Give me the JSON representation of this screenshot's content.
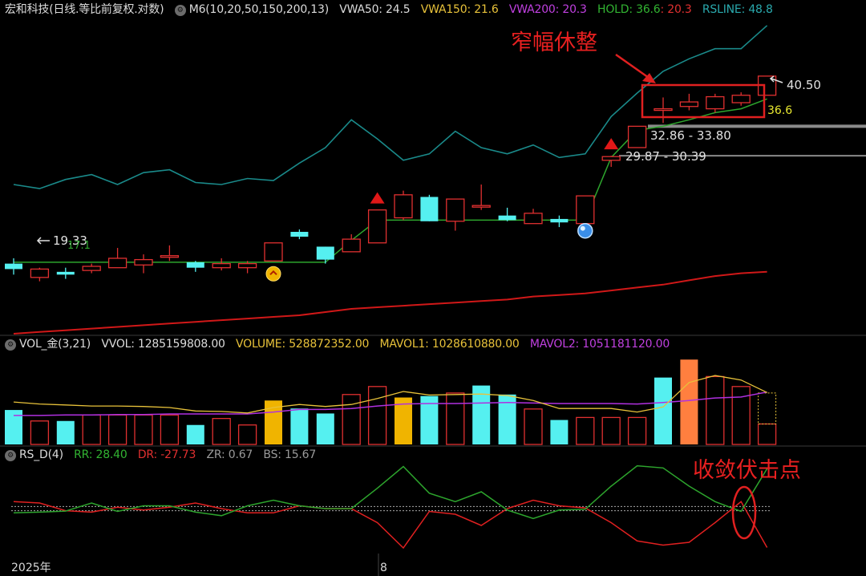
{
  "header": {
    "title": "宏和科技(日线.等比前复权.对数)",
    "indicator": "M6(10,20,50,150,200,13)",
    "vwa50": "VWA50: 24.5",
    "vwa150": "VWA150: 21.6",
    "vwa200": "VWA200: 20.3",
    "hold_green": "HOLD: 36.6",
    "hold_red": ": 20.3",
    "rsline": "RSLINE: 48.8"
  },
  "vol_header": {
    "name": "VOL_金(3,21)",
    "vvol": "VVOL: 1285159808.00",
    "volume": "VOLUME: 528872352.00",
    "mavol1": "MAVOL1: 1028610880.00",
    "mavol2": "MAVOL2: 1051181120.00"
  },
  "rs_header": {
    "name": "RS_D(4)",
    "rr": "RR: 28.40",
    "dr": "DR: -27.73",
    "zr": "ZR: 0.67",
    "bs": "BS: 15.67"
  },
  "annotations": {
    "consolidation": "窄幅休整",
    "convergence": "收敛伏击点",
    "label_high": "40.50",
    "label_hold": "36.6",
    "label_zone1": "32.86 - 33.80",
    "label_zone2": "29.87 - 30.39",
    "label_low": "19.33",
    "label_low_green": "17.1"
  },
  "time_axis": {
    "year_label": "2025年",
    "month_label": "8"
  },
  "colors": {
    "up": "#e03030",
    "down": "#55f0f0",
    "green": "#2da52d",
    "cyan_rs": "#1a8a8a",
    "red_ma": "#d01818",
    "yellow": "#f0b400",
    "orange": "#ff7f3f",
    "magenta": "#b030e0"
  },
  "chart_data": [
    {
      "type": "candlestick",
      "title": "宏和科技(日线.等比前复权.对数)",
      "candles": [
        {
          "o": 20.6,
          "c": 20.2,
          "h": 21.0,
          "l": 19.8
        },
        {
          "o": 19.6,
          "c": 20.2,
          "h": 20.3,
          "l": 19.33
        },
        {
          "o": 20.0,
          "c": 19.8,
          "h": 20.3,
          "l": 19.5
        },
        {
          "o": 20.1,
          "c": 20.4,
          "h": 20.6,
          "l": 19.9
        },
        {
          "o": 20.3,
          "c": 21.0,
          "h": 21.8,
          "l": 20.3
        },
        {
          "o": 20.5,
          "c": 20.9,
          "h": 21.3,
          "l": 19.9
        },
        {
          "o": 21.1,
          "c": 21.2,
          "h": 22.0,
          "l": 20.8
        },
        {
          "o": 20.7,
          "c": 20.3,
          "h": 20.8,
          "l": 20.0
        },
        {
          "o": 20.3,
          "c": 20.6,
          "h": 21.0,
          "l": 20.1
        },
        {
          "o": 20.3,
          "c": 20.6,
          "h": 20.8,
          "l": 19.9
        },
        {
          "o": 20.8,
          "c": 22.2,
          "h": 22.2,
          "l": 20.8
        },
        {
          "o": 23.1,
          "c": 22.7,
          "h": 23.3,
          "l": 22.5
        },
        {
          "o": 21.9,
          "c": 20.9,
          "h": 21.9,
          "l": 20.6
        },
        {
          "o": 21.5,
          "c": 22.5,
          "h": 22.9,
          "l": 21.5
        },
        {
          "o": 22.2,
          "c": 25.0,
          "h": 25.0,
          "l": 22.2
        },
        {
          "o": 24.3,
          "c": 26.4,
          "h": 26.8,
          "l": 24.1
        },
        {
          "o": 26.2,
          "c": 24.0,
          "h": 26.4,
          "l": 24.0
        },
        {
          "o": 24.0,
          "c": 26.0,
          "h": 26.0,
          "l": 23.2
        },
        {
          "o": 25.4,
          "c": 25.4,
          "h": 27.4,
          "l": 25.0
        },
        {
          "o": 24.5,
          "c": 24.1,
          "h": 25.2,
          "l": 24.0
        },
        {
          "o": 23.8,
          "c": 24.7,
          "h": 25.1,
          "l": 23.8
        },
        {
          "o": 24.2,
          "c": 23.9,
          "h": 24.5,
          "l": 23.5
        },
        {
          "o": 23.8,
          "c": 26.3,
          "h": 26.3,
          "l": 23.8
        },
        {
          "o": 29.9,
          "c": 30.3,
          "h": 30.39,
          "l": 29.2
        },
        {
          "o": 31.3,
          "c": 33.8,
          "h": 33.8,
          "l": 31.3
        },
        {
          "o": 35.9,
          "c": 36.0,
          "h": 37.5,
          "l": 34.2
        },
        {
          "o": 36.3,
          "c": 36.9,
          "h": 38.0,
          "l": 35.8
        },
        {
          "o": 36.0,
          "c": 37.6,
          "h": 38.0,
          "l": 35.5
        },
        {
          "o": 36.8,
          "c": 37.8,
          "h": 38.2,
          "l": 36.4
        },
        {
          "o": 37.8,
          "c": 40.5,
          "h": 40.5,
          "l": 37.8
        }
      ],
      "lines": {
        "rsline": [
          27.4,
          27.0,
          27.9,
          28.4,
          27.4,
          28.6,
          28.9,
          27.6,
          27.4,
          28.0,
          27.8,
          29.6,
          31.3,
          34.6,
          32.3,
          29.9,
          30.6,
          33.2,
          31.3,
          30.6,
          31.6,
          30.2,
          30.6,
          35.0,
          38.1,
          41.2,
          43.1,
          44.7,
          44.7,
          48.6
        ],
        "hold": [
          20.7,
          20.7,
          20.7,
          20.7,
          20.7,
          20.7,
          20.7,
          20.7,
          20.7,
          20.7,
          20.7,
          20.7,
          20.7,
          22.4,
          24.1,
          24.1,
          24.1,
          24.1,
          24.1,
          24.1,
          24.1,
          24.1,
          24.1,
          30.2,
          33.3,
          33.8,
          34.6,
          35.5,
          36.0,
          37.3
        ],
        "vwa200": [
          16.0,
          16.1,
          16.2,
          16.3,
          16.4,
          16.5,
          16.6,
          16.7,
          16.8,
          16.9,
          17.0,
          17.1,
          17.3,
          17.5,
          17.6,
          17.7,
          17.8,
          17.9,
          18.0,
          18.1,
          18.3,
          18.4,
          18.5,
          18.7,
          18.9,
          19.1,
          19.4,
          19.7,
          19.9,
          20.0
        ]
      },
      "markers": [
        {
          "index": 10,
          "kind": "buy-circle",
          "at": "low"
        },
        {
          "index": 14,
          "kind": "red-triangle",
          "at": "high"
        },
        {
          "index": 22,
          "kind": "blue-ball",
          "at": "low"
        },
        {
          "index": 23,
          "kind": "red-triangle",
          "at": "high"
        }
      ],
      "ylim": [
        16.0,
        50.0
      ],
      "log_scale": true
    },
    {
      "type": "bar",
      "title": "VOL_金(3,21)",
      "values": [
        690,
        470,
        470,
        590,
        590,
        590,
        590,
        390,
        520,
        390,
        880,
        720,
        620,
        1000,
        1160,
        940,
        970,
        1030,
        1180,
        1000,
        710,
        490,
        540,
        540,
        540,
        1340,
        1700,
        1360,
        1160,
        410
      ],
      "kinds": [
        "down",
        "up",
        "down",
        "up",
        "up",
        "up",
        "up",
        "down",
        "up",
        "up",
        "gold",
        "down",
        "down",
        "up",
        "up",
        "gold",
        "down",
        "up",
        "down",
        "down",
        "up",
        "down",
        "up",
        "up",
        "up",
        "down",
        "orange",
        "up",
        "up",
        "up"
      ],
      "mavol1": [
        850,
        810,
        790,
        770,
        770,
        760,
        740,
        670,
        660,
        630,
        740,
        800,
        760,
        800,
        920,
        1060,
        990,
        1000,
        1010,
        980,
        880,
        720,
        720,
        720,
        650,
        750,
        1240,
        1380,
        1290,
        1040
      ],
      "mavol2": [
        580,
        580,
        590,
        590,
        600,
        600,
        610,
        610,
        610,
        610,
        650,
        700,
        700,
        720,
        770,
        810,
        820,
        820,
        830,
        840,
        830,
        820,
        820,
        820,
        810,
        840,
        880,
        930,
        950,
        1050
      ],
      "ylim": [
        0,
        1800
      ]
    },
    {
      "type": "line",
      "title": "RS_D(4)",
      "series": [
        {
          "name": "RR",
          "values": [
            -3.0,
            -2.5,
            -1.8,
            4.0,
            -2.0,
            2.0,
            2.0,
            -2.5,
            -5.0,
            2.0,
            6.0,
            2.0,
            0.0,
            0.0,
            14.5,
            30.0,
            11.0,
            5.0,
            12.0,
            -1.0,
            -7.0,
            -1.0,
            -0.5,
            16.0,
            30.5,
            29.0,
            16.0,
            5.0,
            -2.0,
            28.4
          ]
        },
        {
          "name": "DR",
          "values": [
            5.0,
            4.0,
            -1.5,
            -2.5,
            1.0,
            -1.0,
            1.0,
            4.0,
            0.0,
            -3.0,
            -3.0,
            2.0,
            0.0,
            0.0,
            -10.0,
            -28.0,
            -2.0,
            -4.0,
            -12.0,
            0.0,
            6.0,
            2.0,
            0.5,
            -10.0,
            -23.0,
            -26.0,
            -24.0,
            -10.0,
            5.0,
            -27.73
          ]
        }
      ],
      "ylim": [
        -32,
        32
      ]
    }
  ]
}
